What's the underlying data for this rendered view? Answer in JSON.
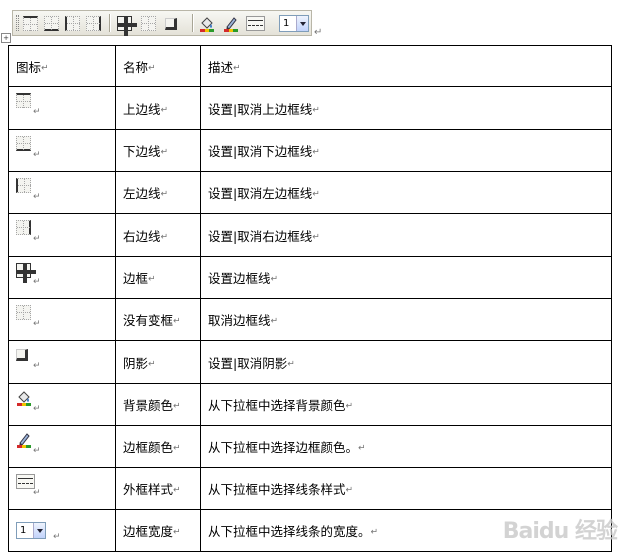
{
  "toolbar": {
    "buttons": [
      {
        "name": "top-border-icon"
      },
      {
        "name": "bottom-border-icon"
      },
      {
        "name": "left-border-icon"
      },
      {
        "name": "right-border-icon"
      },
      {
        "name": "outside-borders-icon"
      },
      {
        "name": "no-border-icon"
      },
      {
        "name": "shadow-icon"
      },
      {
        "name": "shading-color-icon"
      },
      {
        "name": "border-color-icon"
      },
      {
        "name": "border-style-icon"
      }
    ],
    "width_value": "1"
  },
  "table": {
    "headers": [
      "图标",
      "名称",
      "描述"
    ],
    "rows": [
      {
        "icon": "top-border-icon",
        "name": "上边线",
        "desc": "设置|取消上边框线"
      },
      {
        "icon": "bottom-border-icon",
        "name": "下边线",
        "desc": "设置|取消下边框线"
      },
      {
        "icon": "left-border-icon",
        "name": "左边线",
        "desc": "设置|取消左边框线"
      },
      {
        "icon": "right-border-icon",
        "name": "右边线",
        "desc": "设置|取消右边框线"
      },
      {
        "icon": "outside-borders-icon",
        "name": "边框",
        "desc": "设置边框线"
      },
      {
        "icon": "no-border-icon",
        "name": "没有变框",
        "desc": "取消边框线"
      },
      {
        "icon": "shadow-icon",
        "name": "阴影",
        "desc": "设置|取消阴影"
      },
      {
        "icon": "shading-color-icon",
        "name": "背景颜色",
        "desc": "从下拉框中选择背景颜色"
      },
      {
        "icon": "border-color-icon",
        "name": "边框颜色",
        "desc": "从下拉框中选择边框颜色。"
      },
      {
        "icon": "border-style-icon",
        "name": "外框样式",
        "desc": "从下拉框中选择线条样式"
      },
      {
        "icon": "border-width-dropdown",
        "name": "边框宽度",
        "desc": "从下拉框中选择线条的宽度。",
        "icon_value": "1"
      }
    ]
  },
  "marks": {
    "paragraph": "↵"
  },
  "watermark": "Baidu 经验"
}
